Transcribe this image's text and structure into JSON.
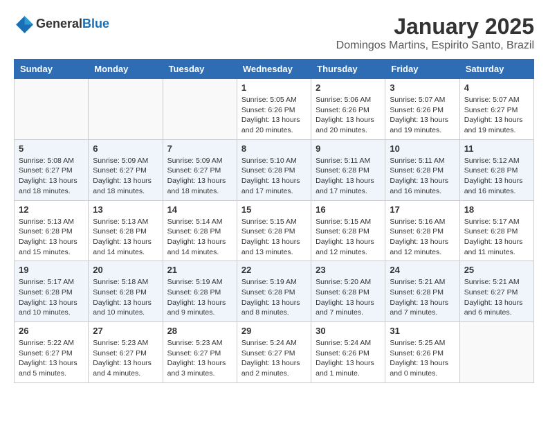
{
  "header": {
    "logo_general": "General",
    "logo_blue": "Blue",
    "month_title": "January 2025",
    "location": "Domingos Martins, Espirito Santo, Brazil"
  },
  "weekdays": [
    "Sunday",
    "Monday",
    "Tuesday",
    "Wednesday",
    "Thursday",
    "Friday",
    "Saturday"
  ],
  "weeks": [
    [
      {
        "day": "",
        "info": ""
      },
      {
        "day": "",
        "info": ""
      },
      {
        "day": "",
        "info": ""
      },
      {
        "day": "1",
        "info": "Sunrise: 5:05 AM\nSunset: 6:26 PM\nDaylight: 13 hours\nand 20 minutes."
      },
      {
        "day": "2",
        "info": "Sunrise: 5:06 AM\nSunset: 6:26 PM\nDaylight: 13 hours\nand 20 minutes."
      },
      {
        "day": "3",
        "info": "Sunrise: 5:07 AM\nSunset: 6:26 PM\nDaylight: 13 hours\nand 19 minutes."
      },
      {
        "day": "4",
        "info": "Sunrise: 5:07 AM\nSunset: 6:27 PM\nDaylight: 13 hours\nand 19 minutes."
      }
    ],
    [
      {
        "day": "5",
        "info": "Sunrise: 5:08 AM\nSunset: 6:27 PM\nDaylight: 13 hours\nand 18 minutes."
      },
      {
        "day": "6",
        "info": "Sunrise: 5:09 AM\nSunset: 6:27 PM\nDaylight: 13 hours\nand 18 minutes."
      },
      {
        "day": "7",
        "info": "Sunrise: 5:09 AM\nSunset: 6:27 PM\nDaylight: 13 hours\nand 18 minutes."
      },
      {
        "day": "8",
        "info": "Sunrise: 5:10 AM\nSunset: 6:28 PM\nDaylight: 13 hours\nand 17 minutes."
      },
      {
        "day": "9",
        "info": "Sunrise: 5:11 AM\nSunset: 6:28 PM\nDaylight: 13 hours\nand 17 minutes."
      },
      {
        "day": "10",
        "info": "Sunrise: 5:11 AM\nSunset: 6:28 PM\nDaylight: 13 hours\nand 16 minutes."
      },
      {
        "day": "11",
        "info": "Sunrise: 5:12 AM\nSunset: 6:28 PM\nDaylight: 13 hours\nand 16 minutes."
      }
    ],
    [
      {
        "day": "12",
        "info": "Sunrise: 5:13 AM\nSunset: 6:28 PM\nDaylight: 13 hours\nand 15 minutes."
      },
      {
        "day": "13",
        "info": "Sunrise: 5:13 AM\nSunset: 6:28 PM\nDaylight: 13 hours\nand 14 minutes."
      },
      {
        "day": "14",
        "info": "Sunrise: 5:14 AM\nSunset: 6:28 PM\nDaylight: 13 hours\nand 14 minutes."
      },
      {
        "day": "15",
        "info": "Sunrise: 5:15 AM\nSunset: 6:28 PM\nDaylight: 13 hours\nand 13 minutes."
      },
      {
        "day": "16",
        "info": "Sunrise: 5:15 AM\nSunset: 6:28 PM\nDaylight: 13 hours\nand 12 minutes."
      },
      {
        "day": "17",
        "info": "Sunrise: 5:16 AM\nSunset: 6:28 PM\nDaylight: 13 hours\nand 12 minutes."
      },
      {
        "day": "18",
        "info": "Sunrise: 5:17 AM\nSunset: 6:28 PM\nDaylight: 13 hours\nand 11 minutes."
      }
    ],
    [
      {
        "day": "19",
        "info": "Sunrise: 5:17 AM\nSunset: 6:28 PM\nDaylight: 13 hours\nand 10 minutes."
      },
      {
        "day": "20",
        "info": "Sunrise: 5:18 AM\nSunset: 6:28 PM\nDaylight: 13 hours\nand 10 minutes."
      },
      {
        "day": "21",
        "info": "Sunrise: 5:19 AM\nSunset: 6:28 PM\nDaylight: 13 hours\nand 9 minutes."
      },
      {
        "day": "22",
        "info": "Sunrise: 5:19 AM\nSunset: 6:28 PM\nDaylight: 13 hours\nand 8 minutes."
      },
      {
        "day": "23",
        "info": "Sunrise: 5:20 AM\nSunset: 6:28 PM\nDaylight: 13 hours\nand 7 minutes."
      },
      {
        "day": "24",
        "info": "Sunrise: 5:21 AM\nSunset: 6:28 PM\nDaylight: 13 hours\nand 7 minutes."
      },
      {
        "day": "25",
        "info": "Sunrise: 5:21 AM\nSunset: 6:27 PM\nDaylight: 13 hours\nand 6 minutes."
      }
    ],
    [
      {
        "day": "26",
        "info": "Sunrise: 5:22 AM\nSunset: 6:27 PM\nDaylight: 13 hours\nand 5 minutes."
      },
      {
        "day": "27",
        "info": "Sunrise: 5:23 AM\nSunset: 6:27 PM\nDaylight: 13 hours\nand 4 minutes."
      },
      {
        "day": "28",
        "info": "Sunrise: 5:23 AM\nSunset: 6:27 PM\nDaylight: 13 hours\nand 3 minutes."
      },
      {
        "day": "29",
        "info": "Sunrise: 5:24 AM\nSunset: 6:27 PM\nDaylight: 13 hours\nand 2 minutes."
      },
      {
        "day": "30",
        "info": "Sunrise: 5:24 AM\nSunset: 6:26 PM\nDaylight: 13 hours\nand 1 minute."
      },
      {
        "day": "31",
        "info": "Sunrise: 5:25 AM\nSunset: 6:26 PM\nDaylight: 13 hours\nand 0 minutes."
      },
      {
        "day": "",
        "info": ""
      }
    ]
  ]
}
